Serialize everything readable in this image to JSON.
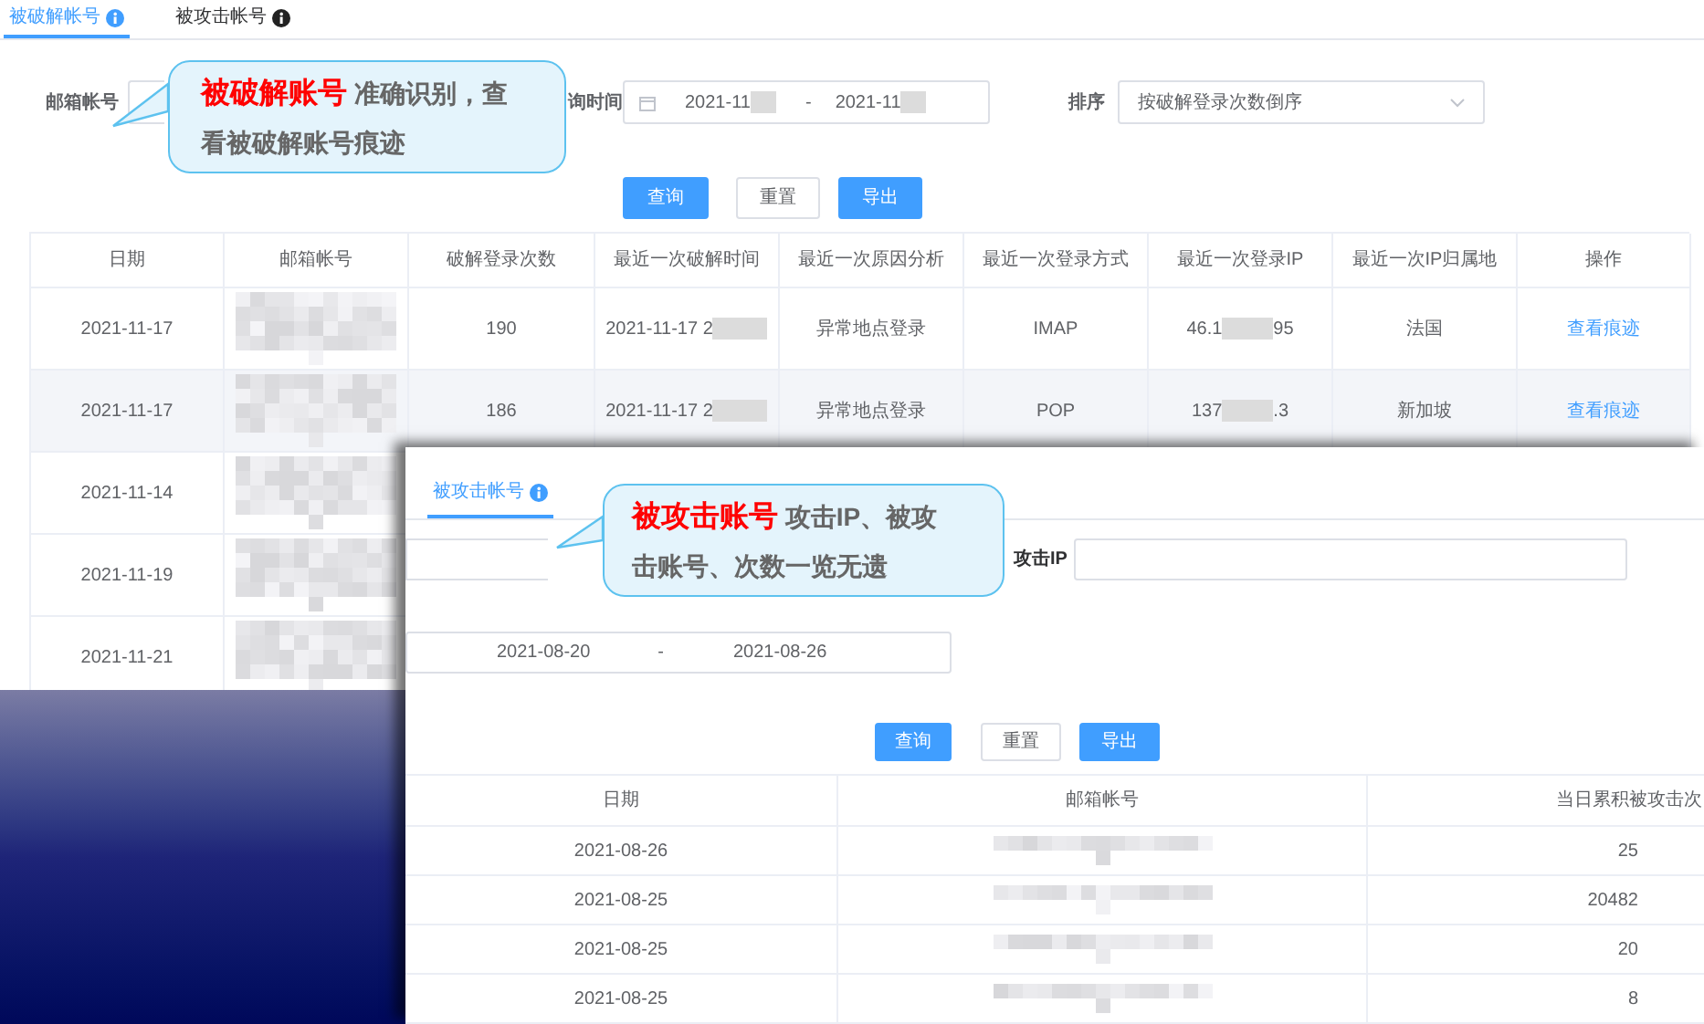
{
  "tabs": [
    {
      "label": "被破解帐号",
      "selected": true
    },
    {
      "label": "被攻击帐号",
      "selected": false
    }
  ],
  "filters": {
    "email_label": "邮箱帐号",
    "time_label": "询时间",
    "date_start": "2021-11",
    "date_sep": "-",
    "date_end": "2021-11",
    "sort_label": "排序",
    "sort_value": "按破解登录次数倒序"
  },
  "buttons": [
    {
      "label": "查询",
      "kind": "primary"
    },
    {
      "label": "重置",
      "kind": "default"
    },
    {
      "label": "导出",
      "kind": "primary"
    }
  ],
  "table": {
    "columns": [
      "日期",
      "邮箱帐号",
      "破解登录次数",
      "最近一次破解时间",
      "最近一次原因分析",
      "最近一次登录方式",
      "最近一次登录IP",
      "最近一次IP归属地",
      "操作"
    ],
    "rows": [
      {
        "date": "2021-11-17",
        "count": "190",
        "time": "2021-11-17 2",
        "reason": "异常地点登录",
        "method": "IMAP",
        "ip_start": "46.1",
        "ip_end": "95",
        "location": "法国",
        "action": "查看痕迹",
        "selected": false
      },
      {
        "date": "2021-11-17",
        "count": "186",
        "time": "2021-11-17 2",
        "reason": "异常地点登录",
        "method": "POP",
        "ip_start": "137",
        "ip_end": ".3",
        "location": "新加坡",
        "action": "查看痕迹",
        "selected": true
      },
      {
        "date": "2021-11-14",
        "selected": false
      },
      {
        "date": "2021-11-19",
        "selected": false
      },
      {
        "date": "2021-11-21",
        "selected": false
      }
    ]
  },
  "callouts": [
    {
      "text": "**被破解账号** 准确识别，查看被破解账号痕迹"
    },
    {
      "text": "**被攻击账号** 攻击IP、被攻击账号、次数一览无遗"
    }
  ],
  "attack_panel": {
    "tabs": [
      {
        "label": "被攻击帐号",
        "selected": true
      }
    ],
    "ip_label": "攻击IP",
    "date_start": "2021-08-20",
    "date_sep": "-",
    "date_end": "2021-08-26",
    "buttons": [
      {
        "label": "查询",
        "kind": "primary"
      },
      {
        "label": "重置",
        "kind": "default"
      },
      {
        "label": "导出",
        "kind": "primary"
      }
    ],
    "table": {
      "columns": [
        "日期",
        "邮箱帐号",
        "当日累积被攻击次"
      ],
      "rows": [
        {
          "date": "2021-08-26",
          "count": "25"
        },
        {
          "date": "2021-08-25",
          "count": "20482"
        },
        {
          "date": "2021-08-25",
          "count": "20"
        },
        {
          "date": "2021-08-25",
          "count": "8"
        }
      ]
    }
  }
}
